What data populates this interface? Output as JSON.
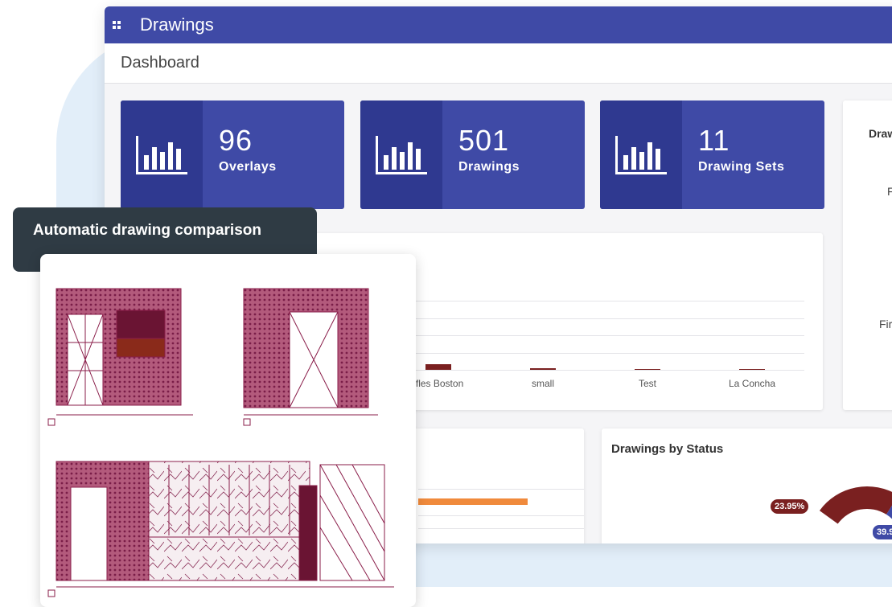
{
  "app": {
    "title": "Drawings",
    "breadcrumb": "Dashboard"
  },
  "stats": [
    {
      "value": "96",
      "label": "Overlays",
      "icon": "bar-chart-icon"
    },
    {
      "value": "501",
      "label": "Drawings",
      "icon": "bar-chart-icon"
    },
    {
      "value": "11",
      "label": "Drawing Sets",
      "icon": "bar-chart-icon"
    }
  ],
  "right_card": {
    "title": "Draw",
    "text1": "F",
    "text2": "Fir"
  },
  "chart_data": [
    {
      "type": "bar",
      "title": "",
      "categories": [
        "ffles Boston",
        "small",
        "Test",
        "La Concha"
      ],
      "values": [
        8,
        2,
        1,
        1
      ],
      "ylim": [
        0,
        100
      ],
      "grid": true,
      "colors": [
        "#7a2020"
      ]
    },
    {
      "type": "pie",
      "title": "Drawings by Status",
      "labels": [
        "23.95%",
        "39.9"
      ],
      "values": [
        23.95,
        39.9
      ],
      "colors": [
        "#7a2020",
        "#3f4aa6"
      ]
    }
  ],
  "bottom_left_card": {
    "bar_color": "#f08a3c"
  },
  "tooltip": {
    "text": "Automatic drawing comparison"
  },
  "drawing": {
    "icon": "architectural-drawing-icon"
  },
  "colors": {
    "primary": "#3f4aa6",
    "primary_dark": "#2f3990",
    "accent": "#7a2020",
    "orange": "#f08a3c",
    "background_blob": "#e2eef9"
  }
}
